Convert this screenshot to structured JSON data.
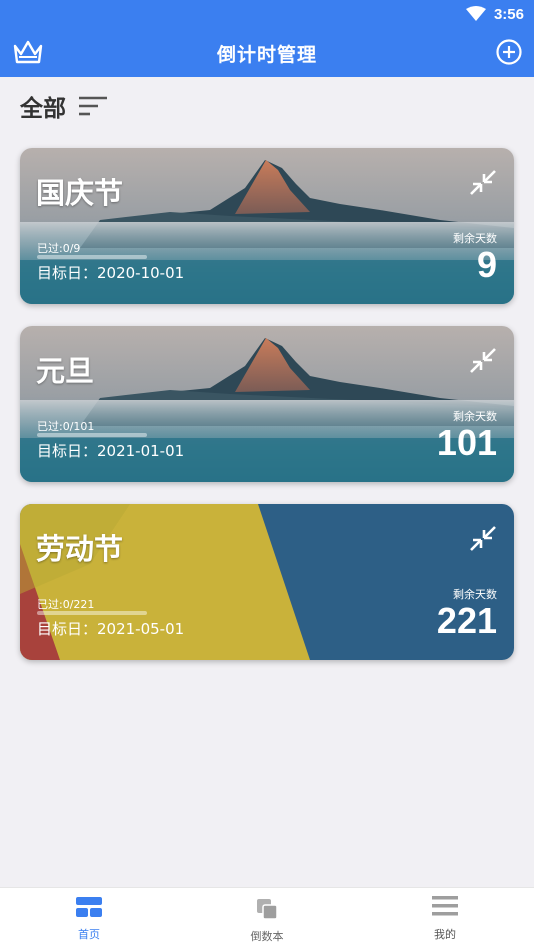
{
  "status": {
    "time": "3:56"
  },
  "header": {
    "title": "倒计时管理"
  },
  "filter": {
    "label": "全部"
  },
  "cards": [
    {
      "title": "国庆节",
      "passed": "已过:0/9",
      "progress": 0,
      "target": "目标日：2020-10-01",
      "remain_label": "剩余天数",
      "remain": "9",
      "background": "mountain"
    },
    {
      "title": "元旦",
      "passed": "已过:0/101",
      "progress": 0,
      "target": "目标日：2021-01-01",
      "remain_label": "剩余天数",
      "remain": "101",
      "background": "mountain"
    },
    {
      "title": "劳动节",
      "passed": "已过:0/221",
      "progress": 0,
      "target": "目标日：2021-05-01",
      "remain_label": "剩余天数",
      "remain": "221",
      "background": "stripes"
    }
  ],
  "nav": [
    {
      "label": "首页",
      "icon": "home-grid-icon",
      "active": true
    },
    {
      "label": "倒数本",
      "icon": "stack-icon",
      "active": false
    },
    {
      "label": "我的",
      "icon": "menu-icon",
      "active": false
    }
  ],
  "colors": {
    "primary": "#3b7ff0",
    "background": "#f1f0f4",
    "nav_inactive": "#9e9e9e"
  }
}
